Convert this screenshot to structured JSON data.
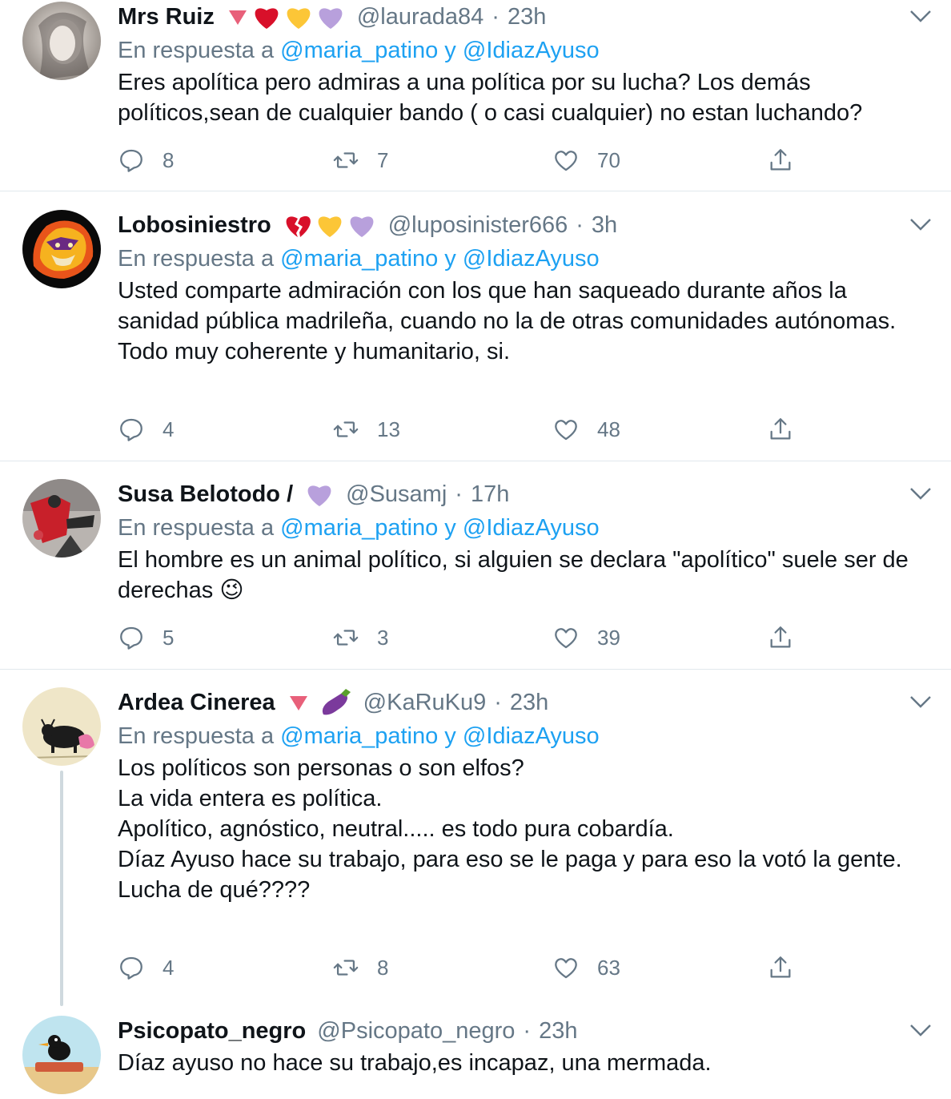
{
  "common": {
    "reply_prefix": "En respuesta a ",
    "reply_user1": "@maria_patino",
    "reply_joiner": " y ",
    "reply_user2": "@IdiazAyuso",
    "dot": "·"
  },
  "tweets": [
    {
      "name": "Mrs Ruiz",
      "handle": "@laurada84",
      "time": "23h",
      "emojis": [
        "down-triangle",
        "red-heart",
        "yellow-heart",
        "purple-heart"
      ],
      "text": "Eres apolítica pero admiras a una política por su lucha? Los demás políticos,sean de cualquier bando ( o casi cualquier) no estan luchando?",
      "replies": "8",
      "retweets": "7",
      "likes": "70"
    },
    {
      "name": "Lobosiniestro",
      "handle": "@luposinister666",
      "time": "3h",
      "emojis": [
        "broken-heart",
        "yellow-heart",
        "purple-heart"
      ],
      "text": "Usted comparte admiración con los que han saqueado durante años la sanidad pública madrileña, cuando no la de otras comunidades autónomas.\nTodo muy coherente y humanitario, si.",
      "replies": "4",
      "retweets": "13",
      "likes": "48"
    },
    {
      "name": "Susa Belotodo /",
      "handle": "@Susamj",
      "time": "17h",
      "emojis": [
        "purple-heart"
      ],
      "text": "El hombre es un animal político, si alguien se declara \"apolítico\" suele ser de derechas 😉",
      "replies": "5",
      "retweets": "3",
      "likes": "39"
    },
    {
      "name": "Ardea Cinerea",
      "handle": "@KaRuKu9",
      "time": "23h",
      "emojis": [
        "down-triangle",
        "eggplant"
      ],
      "text": "Los políticos son personas o son elfos?\nLa vida entera es política.\nApolítico, agnóstico, neutral..... es todo pura cobardía.\nDíaz Ayuso hace su trabajo, para eso se le paga y para eso la votó la gente.\nLucha de qué????",
      "replies": "4",
      "retweets": "8",
      "likes": "63"
    },
    {
      "name": "Psicopato_negro",
      "handle": "@Psicopato_negro",
      "time": "23h",
      "emojis": [],
      "text": "Díaz ayuso no hace su trabajo,es incapaz, una mermada."
    }
  ],
  "colors": {
    "name": "#0f1419",
    "muted": "#657786",
    "link": "#1da1f2",
    "divider": "#e1e8ed"
  }
}
